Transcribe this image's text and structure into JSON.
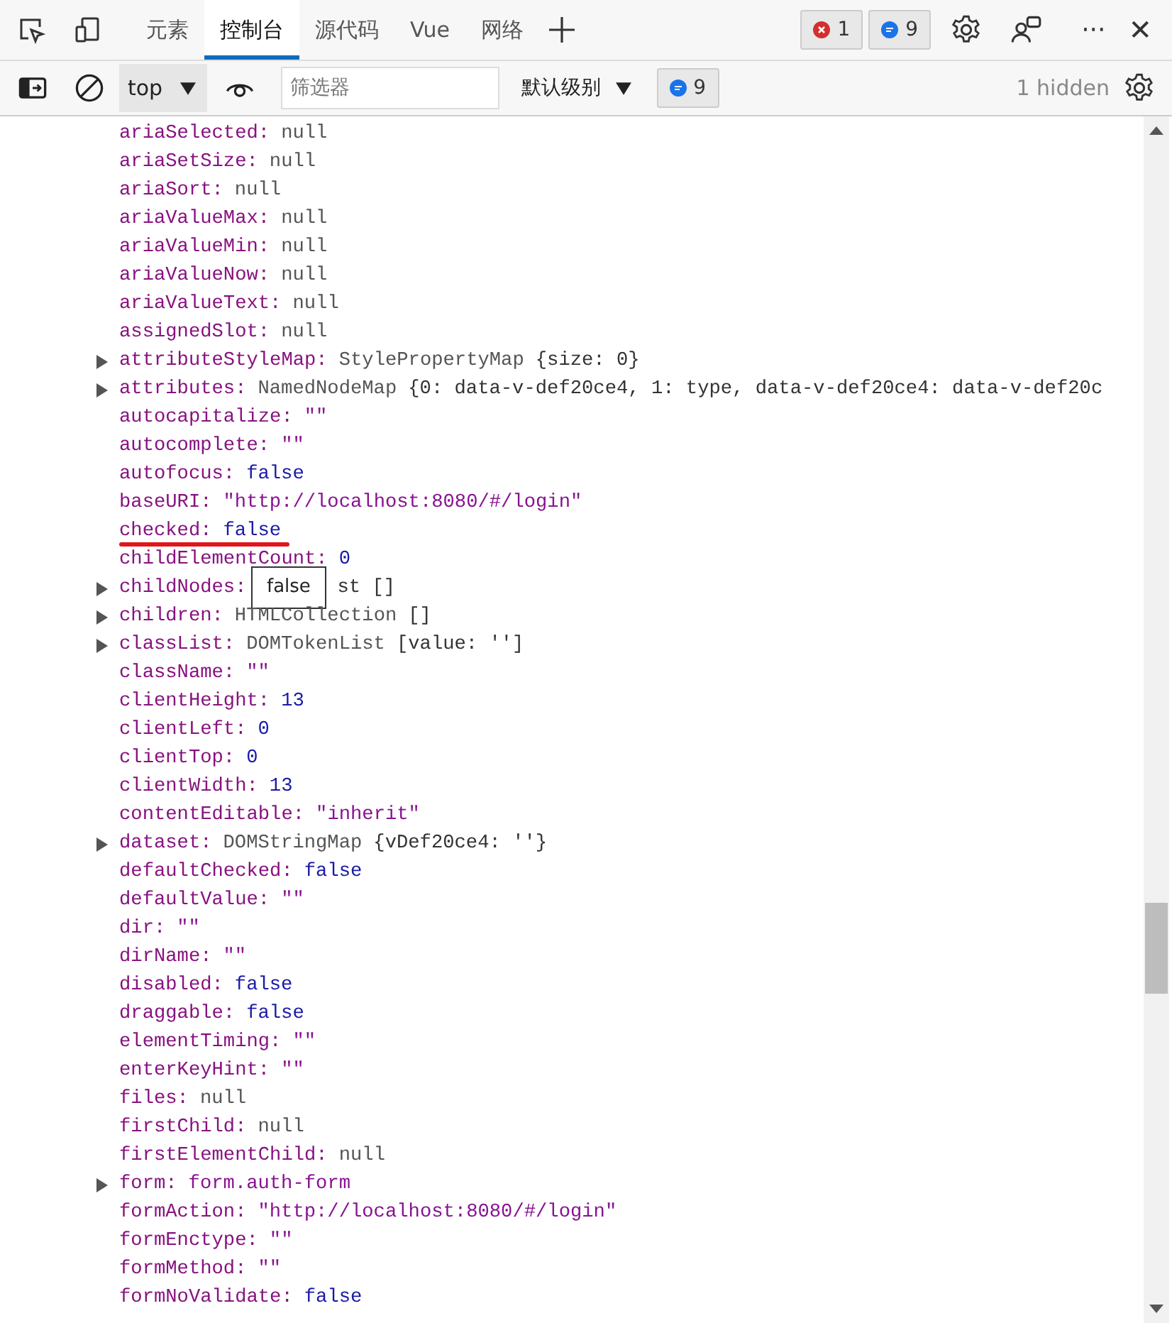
{
  "tabs": [
    {
      "label": "元素",
      "selected": false
    },
    {
      "label": "控制台",
      "selected": true
    },
    {
      "label": "源代码",
      "selected": false
    },
    {
      "label": "Vue",
      "selected": false
    },
    {
      "label": "网络",
      "selected": false
    }
  ],
  "issues": {
    "errors": "1",
    "messages": "9"
  },
  "more": "···",
  "close": "✕",
  "console_toolbar": {
    "context": "top",
    "filter": {
      "placeholder": "筛选器"
    },
    "level": "默认级别",
    "messages": "9",
    "hidden": "1 hidden"
  },
  "properties": [
    {
      "key": "ariaSelected:",
      "kind": "null",
      "value": "null"
    },
    {
      "key": "ariaSetSize:",
      "kind": "null",
      "value": "null"
    },
    {
      "key": "ariaSort:",
      "kind": "null",
      "value": "null"
    },
    {
      "key": "ariaValueMax:",
      "kind": "null",
      "value": "null"
    },
    {
      "key": "ariaValueMin:",
      "kind": "null",
      "value": "null"
    },
    {
      "key": "ariaValueNow:",
      "kind": "null",
      "value": "null"
    },
    {
      "key": "ariaValueText:",
      "kind": "null",
      "value": "null"
    },
    {
      "key": "assignedSlot:",
      "kind": "null",
      "value": "null"
    },
    {
      "key": "attributeStyleMap:",
      "kind": "object",
      "type": "StylePropertyMap",
      "value": "{size: 0}",
      "expandable": true
    },
    {
      "key": "attributes:",
      "kind": "object",
      "type": "NamedNodeMap",
      "value": "{0: data-v-def20ce4, 1: type, data-v-def20ce4: data-v-def20c",
      "expandable": true
    },
    {
      "key": "autocapitalize:",
      "kind": "string",
      "value": "\"\""
    },
    {
      "key": "autocomplete:",
      "kind": "string",
      "value": "\"\""
    },
    {
      "key": "autofocus:",
      "kind": "bool",
      "value": "false"
    },
    {
      "key": "baseURI:",
      "kind": "string",
      "value": "\"http://localhost:8080/#/login\""
    },
    {
      "key": "checked:",
      "kind": "bool",
      "value": "false",
      "underlined": true
    },
    {
      "key": "childElementCount:",
      "kind": "number",
      "value": "0"
    },
    {
      "key": "childNodes:",
      "kind": "covered",
      "value": "st []",
      "expandable": true
    },
    {
      "key": "children:",
      "kind": "object",
      "type": "HTMLCollection",
      "value": "[]",
      "expandable": true
    },
    {
      "key": "classList:",
      "kind": "object",
      "type": "DOMTokenList",
      "value": "[value: '']",
      "expandable": true
    },
    {
      "key": "className:",
      "kind": "string",
      "value": "\"\""
    },
    {
      "key": "clientHeight:",
      "kind": "number",
      "value": "13"
    },
    {
      "key": "clientLeft:",
      "kind": "number",
      "value": "0"
    },
    {
      "key": "clientTop:",
      "kind": "number",
      "value": "0"
    },
    {
      "key": "clientWidth:",
      "kind": "number",
      "value": "13"
    },
    {
      "key": "contentEditable:",
      "kind": "string",
      "value": "\"inherit\""
    },
    {
      "key": "dataset:",
      "kind": "object",
      "type": "DOMStringMap",
      "value": "{vDef20ce4: ''}",
      "expandable": true
    },
    {
      "key": "defaultChecked:",
      "kind": "bool",
      "value": "false"
    },
    {
      "key": "defaultValue:",
      "kind": "string",
      "value": "\"\""
    },
    {
      "key": "dir:",
      "kind": "string",
      "value": "\"\""
    },
    {
      "key": "dirName:",
      "kind": "string",
      "value": "\"\""
    },
    {
      "key": "disabled:",
      "kind": "bool",
      "value": "false"
    },
    {
      "key": "draggable:",
      "kind": "bool",
      "value": "false"
    },
    {
      "key": "elementTiming:",
      "kind": "string",
      "value": "\"\""
    },
    {
      "key": "enterKeyHint:",
      "kind": "string",
      "value": "\"\""
    },
    {
      "key": "files:",
      "kind": "null",
      "value": "null"
    },
    {
      "key": "firstChild:",
      "kind": "null",
      "value": "null"
    },
    {
      "key": "firstElementChild:",
      "kind": "null",
      "value": "null"
    },
    {
      "key": "form:",
      "kind": "element",
      "value": "form.auth-form",
      "expandable": true
    },
    {
      "key": "formAction:",
      "kind": "string",
      "value": "\"http://localhost:8080/#/login\""
    },
    {
      "key": "formEnctype:",
      "kind": "string",
      "value": "\"\""
    },
    {
      "key": "formMethod:",
      "kind": "string",
      "value": "\"\""
    },
    {
      "key": "formNoValidate:",
      "kind": "bool",
      "value": "false"
    }
  ],
  "tooltip": {
    "text": "false"
  }
}
